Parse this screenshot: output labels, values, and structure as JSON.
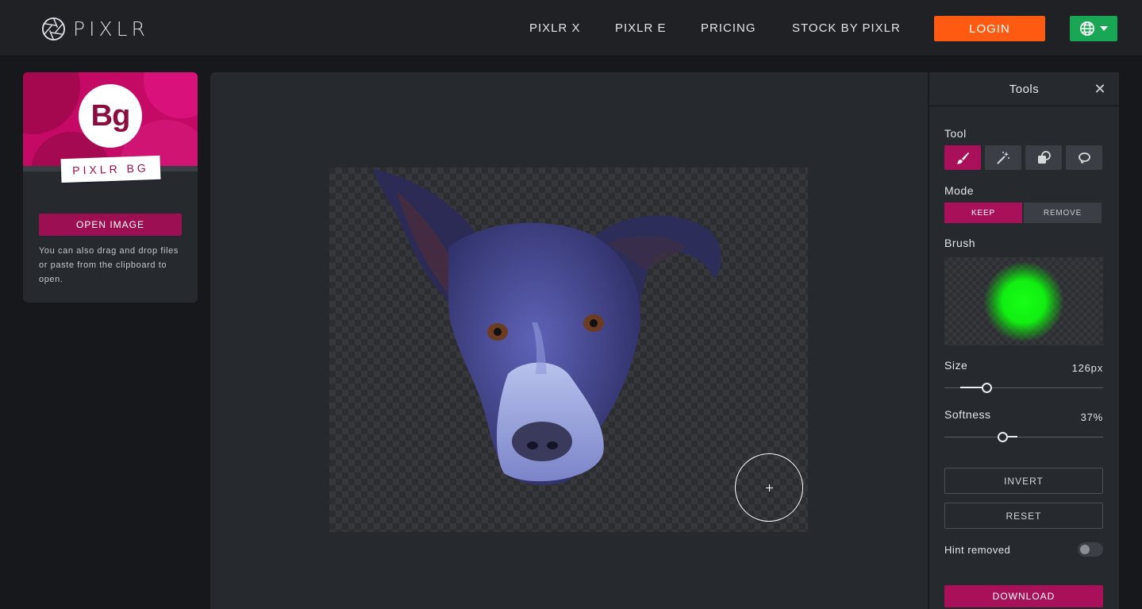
{
  "header": {
    "logo_text": "PIXLR",
    "nav": [
      {
        "label": "PIXLR X"
      },
      {
        "label": "PIXLR E"
      },
      {
        "label": "PRICING"
      },
      {
        "label": "STOCK BY PIXLR"
      }
    ],
    "login_label": "LOGIN",
    "language_icon": "globe-icon",
    "colors": {
      "login": "#ff5a12",
      "language": "#19a655"
    }
  },
  "left_panel": {
    "badge_text": "Bg",
    "product_label": "PIXLR BG",
    "open_button": "OPEN IMAGE",
    "hint": "You can also drag and drop files or paste from the clipboard to open.",
    "brand_color": "#c40a64"
  },
  "tools_panel": {
    "title": "Tools",
    "close_icon": "close-icon",
    "tool_label": "Tool",
    "tools": [
      {
        "name": "brush-icon",
        "active": true
      },
      {
        "name": "magic-wand-icon",
        "active": false
      },
      {
        "name": "shape-fill-icon",
        "active": false
      },
      {
        "name": "lasso-icon",
        "active": false
      }
    ],
    "mode_label": "Mode",
    "modes": [
      {
        "label": "KEEP",
        "active": true
      },
      {
        "label": "REMOVE",
        "active": false
      }
    ],
    "brush_label": "Brush",
    "brush_color": "#17ff17",
    "size_label": "Size",
    "size_value": "126px",
    "size_fraction": 0.27,
    "softness_label": "Softness",
    "softness_value": "37%",
    "softness_fraction": 0.37,
    "invert_label": "INVERT",
    "reset_label": "RESET",
    "hint_label": "Hint removed",
    "hint_enabled": false,
    "download_label": "DOWNLOAD",
    "accent": "#a8105a"
  }
}
